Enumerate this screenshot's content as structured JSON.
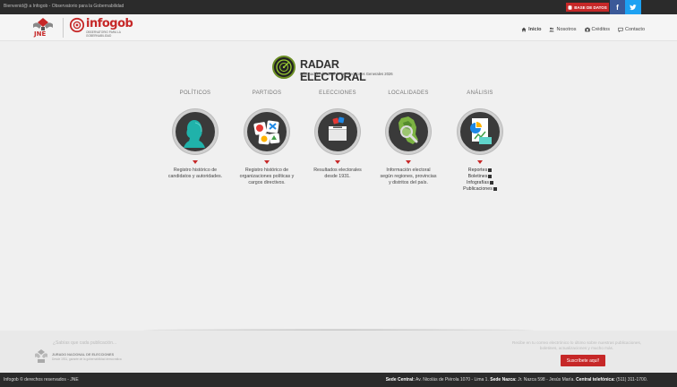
{
  "topbar": {
    "welcome": "Bienvenid@ a Infogob - Observatorio para la Gobernabilidad",
    "db_button": "BASE DE DATOS",
    "facebook": "f"
  },
  "header": {
    "jne_logo_text": "JNE",
    "infogob_name": "infogob",
    "infogob_tagline": "OBSERVATORIO PARA LA GOBERNABILIDAD",
    "nav": [
      {
        "label": "Inicio",
        "icon": "home-icon"
      },
      {
        "label": "Nosotros",
        "icon": "users-icon"
      },
      {
        "label": "Créditos",
        "icon": "camera-icon"
      },
      {
        "label": "Contacto",
        "icon": "chat-icon"
      }
    ]
  },
  "radar": {
    "title": "RADAR ELECTORAL",
    "subtitle": "Información electoral de las Elecciones Generales 2026"
  },
  "categories": [
    {
      "label": "POLÍTICOS",
      "icon": "person-silhouette-icon",
      "desc": "Registro histórico de candidatos y autoridades."
    },
    {
      "label": "PARTIDOS",
      "icon": "party-logos-icon",
      "desc": "Registro histórico de organizaciones políticas y cargos directivos."
    },
    {
      "label": "ELECCIONES",
      "icon": "ballot-box-icon",
      "desc": "Resultados electorales desde 1931."
    },
    {
      "label": "LOCALIDADES",
      "icon": "peru-map-icon",
      "desc": "Información electoral según regiones, provincias y distritos del país."
    },
    {
      "label": "ANÁLISIS",
      "icon": "report-chart-icon",
      "links": [
        "Reportes",
        "Boletines",
        "Infografías",
        "Publicaciones"
      ]
    }
  ],
  "footer": {
    "sabias": "¿Sabías que cada publicación...",
    "jne_name": "JURADO NACIONAL DE ELECCIONES",
    "jne_tag": "Desde 1931, garante de la gobernabilidad democrática",
    "newsletter": "Recibe en tu correo electrónico lo último sobre nuestras publicaciones, boletines, actualizaciones y mucho más.",
    "subscribe": "Suscríbete aquí!"
  },
  "bottombar": {
    "copyright": "Infogob © derechos reservados - JNE",
    "sede_central_label": "Sede Central:",
    "sede_central": "Av. Nicolás de Piérola 1070 - Lima 1.",
    "sede_nazca_label": "Sede Nazca:",
    "sede_nazca": "Jr. Nazca 598 - Jesús María.",
    "central_label": "Central telefónica:",
    "central": "(511) 311-1700."
  }
}
